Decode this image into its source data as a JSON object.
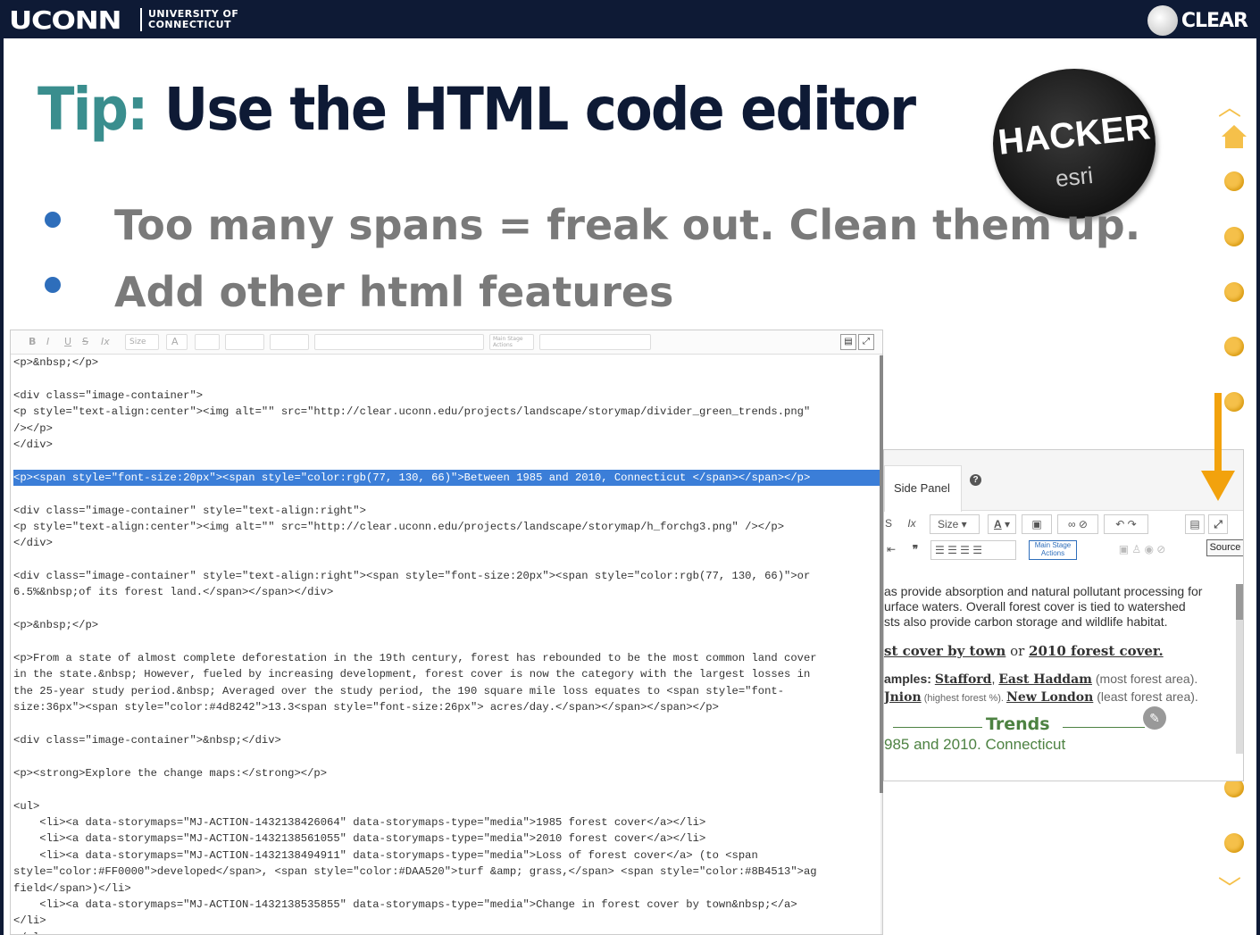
{
  "header": {
    "logo_main": "UCONN",
    "logo_sub_1": "UNIVERSITY OF",
    "logo_sub_2": "CONNECTICUT",
    "clear_logo": "CLEAR"
  },
  "slide": {
    "title_tip": "Tip:",
    "title_rest": " Use the HTML code editor",
    "bullets": [
      "Too many spans = freak out.  Clean them up.",
      "Add other html features"
    ],
    "badge_text_1": "HACKER",
    "badge_text_2": "esri"
  },
  "editor": {
    "toolbar": {
      "bold": "B",
      "italic": "I",
      "underline": "U",
      "strike": "S",
      "clear": "Ix",
      "size": "Size",
      "font_color": "A",
      "main_stage": "Main Stage Actions"
    },
    "code_lines": [
      "<p>&nbsp;</p>",
      "",
      "<div class=\"image-container\">",
      "<p style=\"text-align:center\"><img alt=\"\" src=\"http://clear.uconn.edu/projects/landscape/storymap/divider_green_trends.png\"",
      "/></p>",
      "</div>",
      "",
      "<p><span style=\"font-size:20px\"><span style=\"color:rgb(77, 130, 66)\">Between 1985 and 2010, Connecticut </span></span></p>",
      "",
      "<div class=\"image-container\" style=\"text-align:right\">",
      "<p style=\"text-align:center\"><img alt=\"\" src=\"http://clear.uconn.edu/projects/landscape/storymap/h_forchg3.png\" /></p>",
      "</div>",
      "",
      "<div class=\"image-container\" style=\"text-align:right\"><span style=\"font-size:20px\"><span style=\"color:rgb(77, 130, 66)\">or",
      "6.5%&nbsp;of its forest land.</span></span></div>",
      "",
      "<p>&nbsp;</p>",
      "",
      "<p>From a state of almost complete deforestation in the 19th century, forest has rebounded to be the most common land cover",
      "in the state.&nbsp; However, fueled by increasing development, forest cover is now the category with the largest losses in",
      "the 25-year study period.&nbsp; Averaged over the study period, the 190 square mile loss equates to <span style=\"font-",
      "size:36px\"><span style=\"color:#4d8242\">13.3<span style=\"font-size:26px\"> acres/day.</span></span></span></p>",
      "",
      "<div class=\"image-container\">&nbsp;</div>",
      "",
      "<p><strong>Explore the change maps:</strong></p>",
      "",
      "<ul>",
      "    <li><a data-storymaps=\"MJ-ACTION-1432138426064\" data-storymaps-type=\"media\">1985 forest cover</a></li>",
      "    <li><a data-storymaps=\"MJ-ACTION-1432138561055\" data-storymaps-type=\"media\">2010 forest cover</a></li>",
      "    <li><a data-storymaps=\"MJ-ACTION-1432138494911\" data-storymaps-type=\"media\">Loss of forest cover</a> (to <span",
      "style=\"color:#FF0000\">developed</span>, <span style=\"color:#DAA520\">turf &amp; grass,</span> <span style=\"color:#8B4513\">ag",
      "field</span>)</li>",
      "    <li><a data-storymaps=\"MJ-ACTION-1432138535855\" data-storymaps-type=\"media\">Change in forest cover by town&nbsp;</a>",
      "</li>",
      "</ul>"
    ],
    "highlighted_line_index": 7
  },
  "side_panel": {
    "tab_label": "Side Panel",
    "toolbar_size": "Size",
    "toolbar_font_color": "A",
    "main_stage": "Main Stage Actions",
    "source_tooltip": "Source",
    "content": {
      "line1": "as provide absorption and natural pollutant processing for",
      "line2": "urface waters.  Overall forest cover is tied to watershed",
      "line3": "sts also provide carbon storage and wildlife habitat.",
      "line4_a": "st cover by town",
      "line4_b": " or ",
      "line4_c": "2010 forest cover.",
      "line5_a": "amples: ",
      "line5_b": "Stafford",
      "line5_c": ", ",
      "line5_d": "East Haddam",
      "line5_e": " (most forest area).",
      "line6_a": "Jnion",
      "line6_b": " (highest forest %). ",
      "line6_c": "New London",
      "line6_d": " (least forest area).",
      "trends": "Trends",
      "line7": "985 and 2010, Connecticut"
    }
  },
  "nav": {
    "up": "︿",
    "down": "﹀"
  },
  "colors": {
    "header_bg": "#0e1a35",
    "tip_teal": "#3a8e8e",
    "bullet_blue": "#2e6ebb",
    "nav_gold": "#f5c04a",
    "arrow_orange": "#f2a20d",
    "highlight": "#3b7ed8"
  }
}
